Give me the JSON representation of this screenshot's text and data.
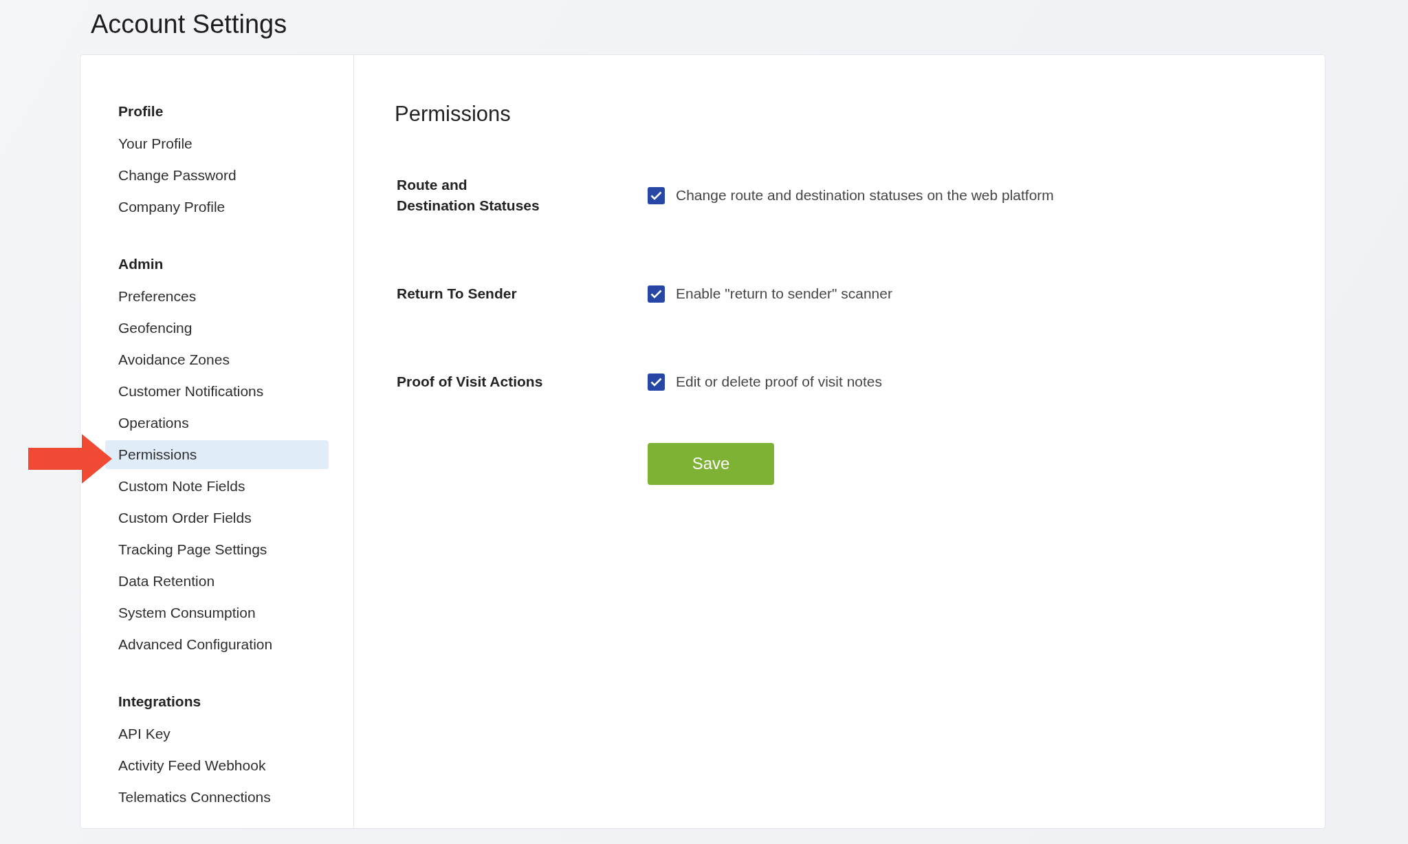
{
  "page": {
    "title": "Account Settings"
  },
  "sidebar": {
    "sections": [
      {
        "heading": "Profile",
        "items": [
          {
            "label": "Your Profile",
            "selected": false
          },
          {
            "label": "Change Password",
            "selected": false
          },
          {
            "label": "Company Profile",
            "selected": false
          }
        ]
      },
      {
        "heading": "Admin",
        "items": [
          {
            "label": "Preferences",
            "selected": false
          },
          {
            "label": "Geofencing",
            "selected": false
          },
          {
            "label": "Avoidance Zones",
            "selected": false
          },
          {
            "label": "Customer Notifications",
            "selected": false
          },
          {
            "label": "Operations",
            "selected": false
          },
          {
            "label": "Permissions",
            "selected": true
          },
          {
            "label": "Custom Note Fields",
            "selected": false
          },
          {
            "label": "Custom Order Fields",
            "selected": false
          },
          {
            "label": "Tracking Page Settings",
            "selected": false
          },
          {
            "label": "Data Retention",
            "selected": false
          },
          {
            "label": "System Consumption",
            "selected": false
          },
          {
            "label": "Advanced Configuration",
            "selected": false
          }
        ]
      },
      {
        "heading": "Integrations",
        "items": [
          {
            "label": "API Key",
            "selected": false
          },
          {
            "label": "Activity Feed Webhook",
            "selected": false
          },
          {
            "label": "Telematics Connections",
            "selected": false
          }
        ]
      }
    ]
  },
  "content": {
    "heading": "Permissions",
    "settings": [
      {
        "label": "Route and Destination Statuses",
        "option": "Change route and destination statuses on the web platform",
        "checked": true
      },
      {
        "label": "Return To Sender",
        "option": "Enable \"return to sender\" scanner",
        "checked": true
      },
      {
        "label": "Proof of Visit Actions",
        "option": "Edit or delete proof of visit notes",
        "checked": true
      }
    ],
    "save_button": "Save"
  }
}
